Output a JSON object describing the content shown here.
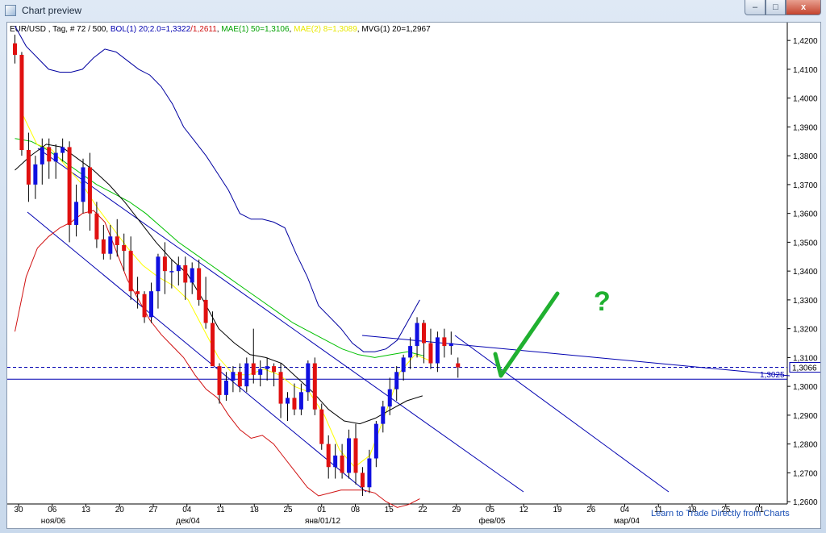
{
  "window": {
    "title": "Chart preview",
    "controls": {
      "minimize": "–",
      "maximize": "□",
      "close": "x"
    }
  },
  "header": {
    "symbol": "EUR/USD , Tag, # 72 / 500, ",
    "bol": "BOL(1) 20;2.0=1,3322",
    "bol_low": "/1,2611",
    "mae1": "MAE(1) 50=1,3106",
    "mae2": "MAE(2) 8=1,3089",
    "mvg": "MVG(1) 20=1,2967"
  },
  "link_text": "Learn to Trade Directly from Charts",
  "annotation": {
    "question": "?"
  },
  "price_labels": {
    "line": "1,3025",
    "current": "1,3066"
  },
  "colors": {
    "up_candle": "#1010e0",
    "down_candle": "#e01010",
    "bollinger": "#0000a0",
    "bol_low": "#d01010",
    "mae50": "#00c000",
    "mae8": "#ffff00",
    "mvg20": "#000000",
    "channel": "#0000b0",
    "check": "#20b030"
  },
  "chart_data": {
    "type": "candlestick",
    "y_axis": {
      "min": 1.255,
      "max": 1.425,
      "ticks": [
        "1,2600",
        "1,2700",
        "1,2800",
        "1,2900",
        "1,3000",
        "1,3100",
        "1,3200",
        "1,3300",
        "1,3400",
        "1,3500",
        "1,3600",
        "1,3700",
        "1,3800",
        "1,3900",
        "1,4000",
        "1,4100",
        "1,4200"
      ]
    },
    "x_axis": {
      "day_labels": [
        "30",
        "06",
        "13",
        "20",
        "27",
        "04",
        "11",
        "18",
        "25",
        "01",
        "08",
        "15",
        "22",
        "29",
        "05",
        "12",
        "19",
        "26",
        "04",
        "11",
        "18",
        "25",
        "01"
      ],
      "month_labels": [
        "ноя/06",
        "дек/04",
        "янв/01/12",
        "фев/05",
        "мар/04"
      ]
    },
    "candles": [
      [
        1.419,
        1.422,
        1.412,
        1.415
      ],
      [
        1.415,
        1.416,
        1.38,
        1.382
      ],
      [
        1.382,
        1.388,
        1.364,
        1.37
      ],
      [
        1.37,
        1.38,
        1.365,
        1.377
      ],
      [
        1.377,
        1.386,
        1.37,
        1.383
      ],
      [
        1.383,
        1.386,
        1.372,
        1.378
      ],
      [
        1.378,
        1.384,
        1.372,
        1.381
      ],
      [
        1.381,
        1.386,
        1.378,
        1.383
      ],
      [
        1.383,
        1.385,
        1.35,
        1.356
      ],
      [
        1.356,
        1.37,
        1.352,
        1.364
      ],
      [
        1.364,
        1.379,
        1.36,
        1.376
      ],
      [
        1.376,
        1.381,
        1.354,
        1.36
      ],
      [
        1.36,
        1.364,
        1.348,
        1.351
      ],
      [
        1.351,
        1.356,
        1.344,
        1.346
      ],
      [
        1.346,
        1.356,
        1.344,
        1.352
      ],
      [
        1.352,
        1.358,
        1.345,
        1.349
      ],
      [
        1.349,
        1.353,
        1.34,
        1.347
      ],
      [
        1.347,
        1.352,
        1.33,
        1.333
      ],
      [
        1.333,
        1.338,
        1.327,
        1.332
      ],
      [
        1.332,
        1.333,
        1.322,
        1.324
      ],
      [
        1.324,
        1.336,
        1.322,
        1.333
      ],
      [
        1.333,
        1.346,
        1.327,
        1.345
      ],
      [
        1.345,
        1.35,
        1.332,
        1.34
      ],
      [
        1.34,
        1.344,
        1.334,
        1.34
      ],
      [
        1.34,
        1.345,
        1.335,
        1.342
      ],
      [
        1.342,
        1.345,
        1.33,
        1.336
      ],
      [
        1.336,
        1.343,
        1.332,
        1.341
      ],
      [
        1.341,
        1.344,
        1.328,
        1.33
      ],
      [
        1.33,
        1.338,
        1.32,
        1.322
      ],
      [
        1.322,
        1.326,
        1.31,
        1.307
      ],
      [
        1.307,
        1.308,
        1.294,
        1.297
      ],
      [
        1.297,
        1.305,
        1.295,
        1.302
      ],
      [
        1.302,
        1.307,
        1.298,
        1.305
      ],
      [
        1.305,
        1.308,
        1.298,
        1.3
      ],
      [
        1.3,
        1.31,
        1.298,
        1.308
      ],
      [
        1.308,
        1.32,
        1.301,
        1.304
      ],
      [
        1.304,
        1.309,
        1.3,
        1.306
      ],
      [
        1.306,
        1.31,
        1.302,
        1.307
      ],
      [
        1.307,
        1.308,
        1.3,
        1.305
      ],
      [
        1.305,
        1.308,
        1.289,
        1.294
      ],
      [
        1.294,
        1.298,
        1.288,
        1.296
      ],
      [
        1.296,
        1.301,
        1.29,
        1.292
      ],
      [
        1.292,
        1.301,
        1.29,
        1.298
      ],
      [
        1.298,
        1.309,
        1.295,
        1.308
      ],
      [
        1.308,
        1.31,
        1.29,
        1.292
      ],
      [
        1.292,
        1.294,
        1.278,
        1.28
      ],
      [
        1.28,
        1.283,
        1.268,
        1.272
      ],
      [
        1.272,
        1.28,
        1.268,
        1.276
      ],
      [
        1.276,
        1.28,
        1.268,
        1.27
      ],
      [
        1.27,
        1.285,
        1.268,
        1.282
      ],
      [
        1.282,
        1.287,
        1.266,
        1.27
      ],
      [
        1.27,
        1.272,
        1.262,
        1.265
      ],
      [
        1.265,
        1.278,
        1.263,
        1.275
      ],
      [
        1.275,
        1.288,
        1.272,
        1.287
      ],
      [
        1.287,
        1.295,
        1.284,
        1.293
      ],
      [
        1.293,
        1.303,
        1.29,
        1.299
      ],
      [
        1.299,
        1.307,
        1.295,
        1.305
      ],
      [
        1.305,
        1.311,
        1.302,
        1.31
      ],
      [
        1.31,
        1.317,
        1.306,
        1.314
      ],
      [
        1.314,
        1.324,
        1.31,
        1.322
      ],
      [
        1.322,
        1.323,
        1.308,
        1.315
      ],
      [
        1.315,
        1.32,
        1.306,
        1.308
      ],
      [
        1.308,
        1.319,
        1.305,
        1.317
      ],
      [
        1.317,
        1.32,
        1.31,
        1.314
      ],
      [
        1.314,
        1.319,
        1.311,
        1.315
      ],
      [
        1.308,
        1.31,
        1.303,
        1.3066
      ]
    ],
    "bol_upper": [
      1.425,
      1.418,
      1.414,
      1.41,
      1.409,
      1.409,
      1.41,
      1.414,
      1.417,
      1.416,
      1.413,
      1.41,
      1.408,
      1.404,
      1.398,
      1.39,
      1.385,
      1.38,
      1.374,
      1.368,
      1.36,
      1.358,
      1.358,
      1.357,
      1.355,
      1.346,
      1.338,
      1.328,
      1.324,
      1.32,
      1.315,
      1.312,
      1.312,
      1.313,
      1.316,
      1.323,
      1.33
    ],
    "bol_lower": [
      1.319,
      1.338,
      1.348,
      1.352,
      1.355,
      1.357,
      1.36,
      1.361,
      1.357,
      1.347,
      1.337,
      1.33,
      1.323,
      1.318,
      1.314,
      1.31,
      1.304,
      1.299,
      1.296,
      1.29,
      1.285,
      1.282,
      1.283,
      1.28,
      1.275,
      1.27,
      1.265,
      1.262,
      1.263,
      1.264,
      1.264,
      1.264,
      1.263,
      1.26,
      1.258,
      1.259,
      1.261
    ],
    "mae50": [
      1.386,
      1.385,
      1.382,
      1.378,
      1.374,
      1.37,
      1.367,
      1.364,
      1.36,
      1.355,
      1.35,
      1.346,
      1.342,
      1.338,
      1.334,
      1.33,
      1.326,
      1.322,
      1.319,
      1.316,
      1.313,
      1.311,
      1.31,
      1.311,
      1.312,
      1.3106
    ],
    "mae8": [
      1.395,
      1.384,
      1.382,
      1.376,
      1.37,
      1.362,
      1.355,
      1.348,
      1.342,
      1.338,
      1.335,
      1.33,
      1.32,
      1.31,
      1.304,
      1.304,
      1.306,
      1.304,
      1.3,
      1.298,
      1.29,
      1.278,
      1.272,
      1.276,
      1.29,
      1.305,
      1.311,
      1.3089
    ],
    "mvg20": [
      1.375,
      1.38,
      1.384,
      1.383,
      1.379,
      1.375,
      1.37,
      1.364,
      1.357,
      1.35,
      1.344,
      1.339,
      1.33,
      1.32,
      1.315,
      1.311,
      1.31,
      1.308,
      1.303,
      1.298,
      1.292,
      1.288,
      1.287,
      1.289,
      1.292,
      1.295,
      1.2967
    ],
    "horizontal_line": 1.3025,
    "current_price": 1.3066
  }
}
